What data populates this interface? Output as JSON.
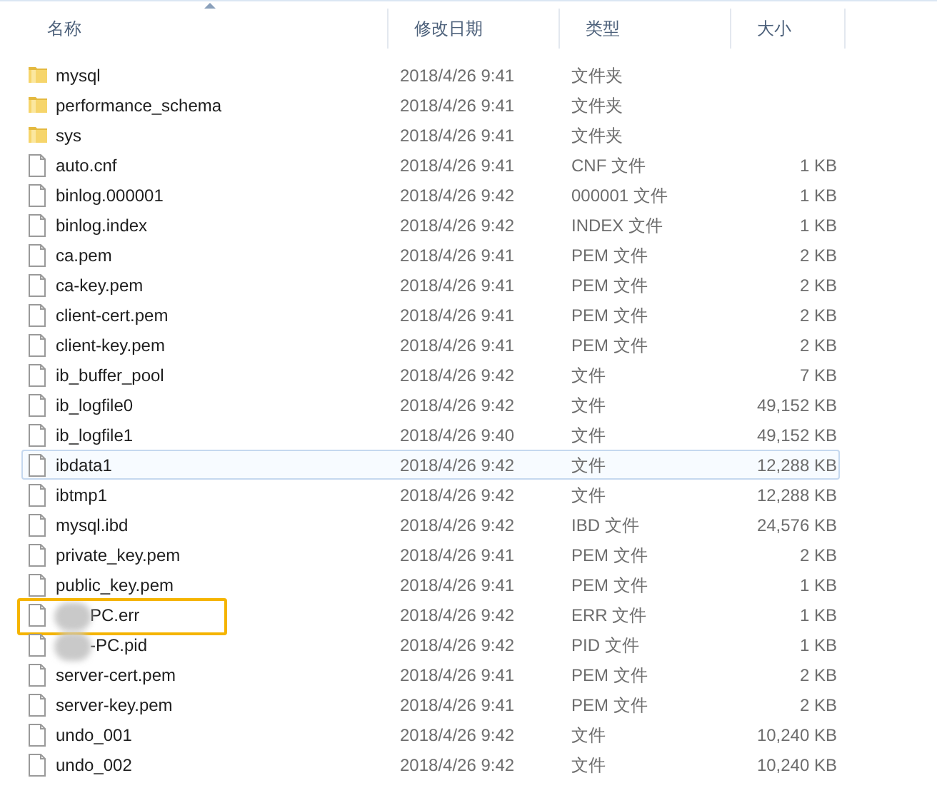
{
  "columns": [
    {
      "label": "名称",
      "sorted": true
    },
    {
      "label": "修改日期",
      "sorted": false
    },
    {
      "label": "类型",
      "sorted": false
    },
    {
      "label": "大小",
      "sorted": false
    }
  ],
  "rows": [
    {
      "kind": "folder",
      "name": "mysql",
      "date": "2018/4/26 9:41",
      "type": "文件夹",
      "hovered": false,
      "outlined": false,
      "redacted": false
    },
    {
      "kind": "folder",
      "name": "performance_schema",
      "date": "2018/4/26 9:41",
      "type": "文件夹",
      "hovered": false,
      "outlined": false,
      "redacted": false
    },
    {
      "kind": "folder",
      "name": "sys",
      "date": "2018/4/26 9:41",
      "type": "文件夹",
      "hovered": false,
      "outlined": false,
      "redacted": false
    },
    {
      "kind": "file",
      "name": "auto.cnf",
      "date": "2018/4/26 9:41",
      "type": "CNF 文件",
      "size": "1 KB",
      "hovered": false,
      "outlined": false,
      "redacted": false
    },
    {
      "kind": "file",
      "name": "binlog.000001",
      "date": "2018/4/26 9:42",
      "type": "000001 文件",
      "size": "1 KB",
      "hovered": false,
      "outlined": false,
      "redacted": false
    },
    {
      "kind": "file",
      "name": "binlog.index",
      "date": "2018/4/26 9:42",
      "type": "INDEX 文件",
      "size": "1 KB",
      "hovered": false,
      "outlined": false,
      "redacted": false
    },
    {
      "kind": "file",
      "name": "ca.pem",
      "date": "2018/4/26 9:41",
      "type": "PEM 文件",
      "size": "2 KB",
      "hovered": false,
      "outlined": false,
      "redacted": false
    },
    {
      "kind": "file",
      "name": "ca-key.pem",
      "date": "2018/4/26 9:41",
      "type": "PEM 文件",
      "size": "2 KB",
      "hovered": false,
      "outlined": false,
      "redacted": false
    },
    {
      "kind": "file",
      "name": "client-cert.pem",
      "date": "2018/4/26 9:41",
      "type": "PEM 文件",
      "size": "2 KB",
      "hovered": false,
      "outlined": false,
      "redacted": false
    },
    {
      "kind": "file",
      "name": "client-key.pem",
      "date": "2018/4/26 9:41",
      "type": "PEM 文件",
      "size": "2 KB",
      "hovered": false,
      "outlined": false,
      "redacted": false
    },
    {
      "kind": "file",
      "name": "ib_buffer_pool",
      "date": "2018/4/26 9:42",
      "type": "文件",
      "size": "7 KB",
      "hovered": false,
      "outlined": false,
      "redacted": false
    },
    {
      "kind": "file",
      "name": "ib_logfile0",
      "date": "2018/4/26 9:42",
      "type": "文件",
      "size": "49,152 KB",
      "hovered": false,
      "outlined": false,
      "redacted": false
    },
    {
      "kind": "file",
      "name": "ib_logfile1",
      "date": "2018/4/26 9:40",
      "type": "文件",
      "size": "49,152 KB",
      "hovered": false,
      "outlined": false,
      "redacted": false
    },
    {
      "kind": "file",
      "name": "ibdata1",
      "date": "2018/4/26 9:42",
      "type": "文件",
      "size": "12,288 KB",
      "hovered": true,
      "outlined": false,
      "redacted": false
    },
    {
      "kind": "file",
      "name": "ibtmp1",
      "date": "2018/4/26 9:42",
      "type": "文件",
      "size": "12,288 KB",
      "hovered": false,
      "outlined": false,
      "redacted": false
    },
    {
      "kind": "file",
      "name": "mysql.ibd",
      "date": "2018/4/26 9:42",
      "type": "IBD 文件",
      "size": "24,576 KB",
      "hovered": false,
      "outlined": false,
      "redacted": false
    },
    {
      "kind": "file",
      "name": "private_key.pem",
      "date": "2018/4/26 9:41",
      "type": "PEM 文件",
      "size": "2 KB",
      "hovered": false,
      "outlined": false,
      "redacted": false
    },
    {
      "kind": "file",
      "name": "public_key.pem",
      "date": "2018/4/26 9:41",
      "type": "PEM 文件",
      "size": "1 KB",
      "hovered": false,
      "outlined": false,
      "redacted": false
    },
    {
      "kind": "file",
      "name": "PC.err",
      "date": "2018/4/26 9:42",
      "type": "ERR 文件",
      "size": "1 KB",
      "hovered": false,
      "outlined": true,
      "redacted": true
    },
    {
      "kind": "file",
      "name": "-PC.pid",
      "date": "2018/4/26 9:42",
      "type": "PID 文件",
      "size": "1 KB",
      "hovered": false,
      "outlined": false,
      "redacted": true
    },
    {
      "kind": "file",
      "name": "server-cert.pem",
      "date": "2018/4/26 9:41",
      "type": "PEM 文件",
      "size": "2 KB",
      "hovered": false,
      "outlined": false,
      "redacted": false
    },
    {
      "kind": "file",
      "name": "server-key.pem",
      "date": "2018/4/26 9:41",
      "type": "PEM 文件",
      "size": "2 KB",
      "hovered": false,
      "outlined": false,
      "redacted": false
    },
    {
      "kind": "file",
      "name": "undo_001",
      "date": "2018/4/26 9:42",
      "type": "文件",
      "size": "10,240 KB",
      "hovered": false,
      "outlined": false,
      "redacted": false
    },
    {
      "kind": "file",
      "name": "undo_002",
      "date": "2018/4/26 9:42",
      "type": "文件",
      "size": "10,240 KB",
      "hovered": false,
      "outlined": false,
      "redacted": false
    }
  ]
}
